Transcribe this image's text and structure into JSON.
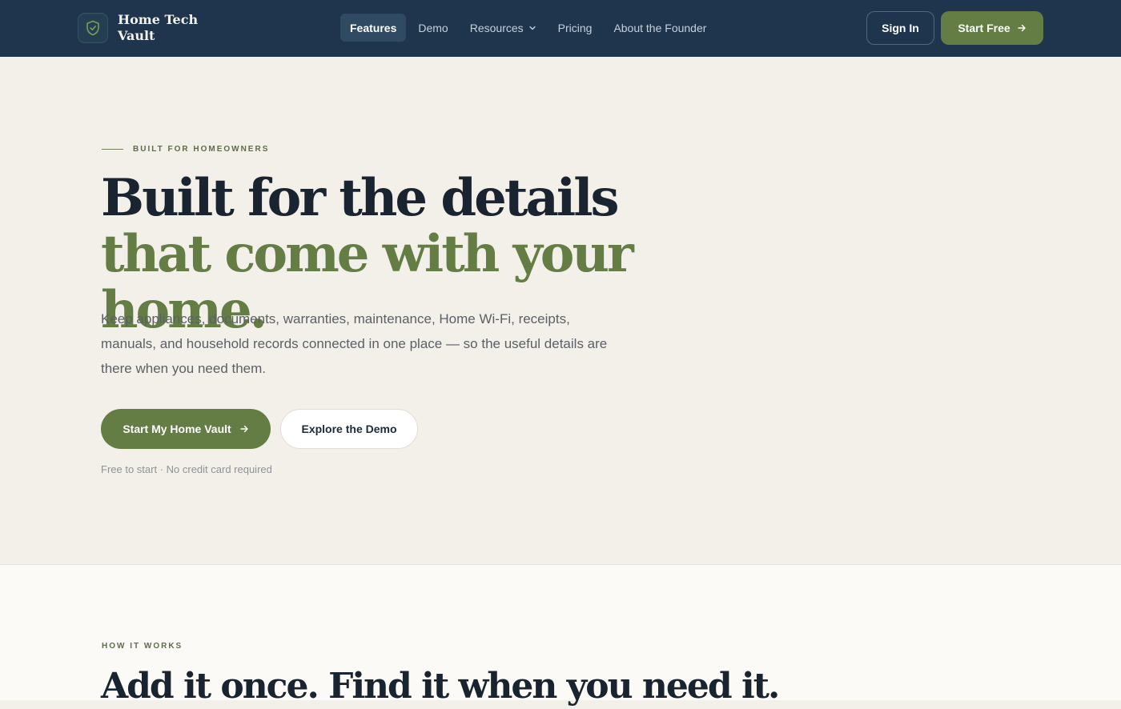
{
  "nav": {
    "brand": "Home Tech Vault",
    "brand_icon": "shield-check-icon",
    "links": [
      {
        "label": "Features",
        "active": true
      },
      {
        "label": "Demo",
        "active": false
      },
      {
        "label": "Resources",
        "active": false,
        "has_dropdown": true
      },
      {
        "label": "Pricing",
        "active": false
      },
      {
        "label": "About the Founder",
        "active": false
      }
    ],
    "sign_in": "Sign In",
    "start_free": "Start Free"
  },
  "hero": {
    "eyebrow": "BUILT FOR HOMEOWNERS",
    "headline_line1": "Built for the details",
    "headline_line2": "that come with your home.",
    "lede": "Keep appliances, documents, warranties, maintenance, Home Wi-Fi, receipts, manuals, and household records connected in one place — so the useful details are there when you need them.",
    "primary_cta": "Start My Home Vault",
    "secondary_cta": "Explore the Demo",
    "fine_print": "Free to start · No credit card required"
  },
  "how_it_works": {
    "eyebrow": "HOW IT WORKS",
    "title": "Add it once. Find it when you need it."
  },
  "colors": {
    "nav_bg": "#1f354d",
    "accent_green": "#637d45",
    "hero_bg": "#f2f0e9",
    "section_bg": "#fbfaf6"
  }
}
